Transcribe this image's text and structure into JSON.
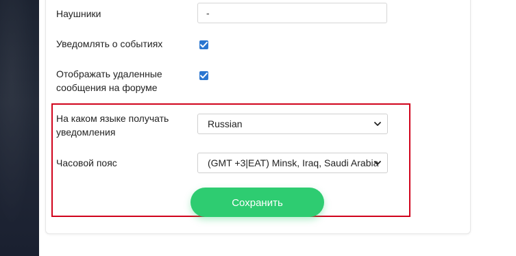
{
  "form": {
    "headphones": {
      "label": "Наушники",
      "value": "-"
    },
    "notify_events": {
      "label": "Уведомлять о событиях",
      "checked": true
    },
    "show_deleted": {
      "label_line1": "Отображать удаленные",
      "label_line2": "сообщения на форуме",
      "checked": true
    },
    "notify_language": {
      "label_line1": "На каком языке получать",
      "label_line2": "уведомления",
      "selected": "Russian"
    },
    "timezone": {
      "label": "Часовой пояс",
      "selected": "(GMT +3|EAT) Minsk, Iraq, Saudi Arabia"
    },
    "save_label": "Сохранить"
  },
  "colors": {
    "accent_green": "#2ecc71",
    "checkbox_blue": "#2b76d0",
    "highlight_red": "#d0021b",
    "sidebar_dark": "#1c2331"
  },
  "icons": {
    "checkbox": "check-icon",
    "select": "chevron-down-icon"
  }
}
